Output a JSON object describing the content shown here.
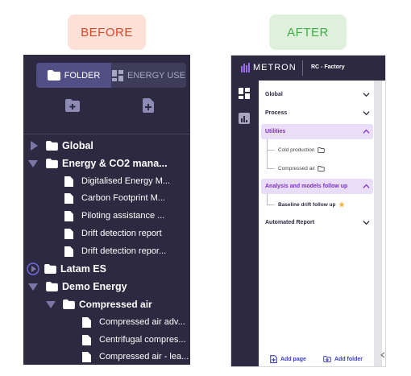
{
  "labels": {
    "before": "BEFORE",
    "after": "AFTER"
  },
  "before_panel": {
    "tabs": [
      {
        "label": "FOLDER",
        "active": true
      },
      {
        "label": "ENERGY USE",
        "active": false
      }
    ],
    "tree": [
      {
        "label": "Global",
        "level": 0,
        "type": "folder",
        "expanded": false
      },
      {
        "label": "Energy & CO2 mana...",
        "level": 0,
        "type": "folder",
        "expanded": true
      },
      {
        "label": "Digitalised Energy M...",
        "level": 1,
        "type": "page"
      },
      {
        "label": "Carbon Footprint M...",
        "level": 1,
        "type": "page"
      },
      {
        "label": "Piloting assistance ...",
        "level": 1,
        "type": "page"
      },
      {
        "label": "Drift detection report",
        "level": 1,
        "type": "page"
      },
      {
        "label": "Drift detection repor...",
        "level": 1,
        "type": "page"
      },
      {
        "label": "Latam ES",
        "level": 0,
        "type": "folder",
        "expanded": false,
        "highlight": true
      },
      {
        "label": "Demo Energy",
        "level": 0,
        "type": "folder",
        "expanded": true
      },
      {
        "label": "Compressed air",
        "level": 1,
        "type": "folder",
        "expanded": true
      },
      {
        "label": "Compressed air adv...",
        "level": 2,
        "type": "page"
      },
      {
        "label": "Centrifugal compres...",
        "level": 2,
        "type": "page"
      },
      {
        "label": "Compressed air - lea...",
        "level": 2,
        "type": "page"
      }
    ]
  },
  "after_panel": {
    "brand": "METRON",
    "site": "RC - Factory",
    "sections": [
      {
        "label": "Global",
        "expanded": false
      },
      {
        "label": "Process",
        "expanded": false
      },
      {
        "label": "Utilities",
        "expanded": true,
        "children": [
          {
            "label": "Cold production"
          },
          {
            "label": "Compressed air"
          }
        ]
      },
      {
        "label": "Analysis and models follow up",
        "expanded": true,
        "children": [
          {
            "label": "Baseline drift follow up",
            "favorite": true
          }
        ]
      },
      {
        "label": "Automated Report",
        "expanded": false
      }
    ],
    "footer": {
      "add_page": "Add page",
      "add_folder": "Add folder"
    }
  },
  "colors": {
    "panel": "#2c2940",
    "accent": "#7c2fc9",
    "active_bg": "#e9ddf7",
    "link": "#3c3fb4"
  }
}
